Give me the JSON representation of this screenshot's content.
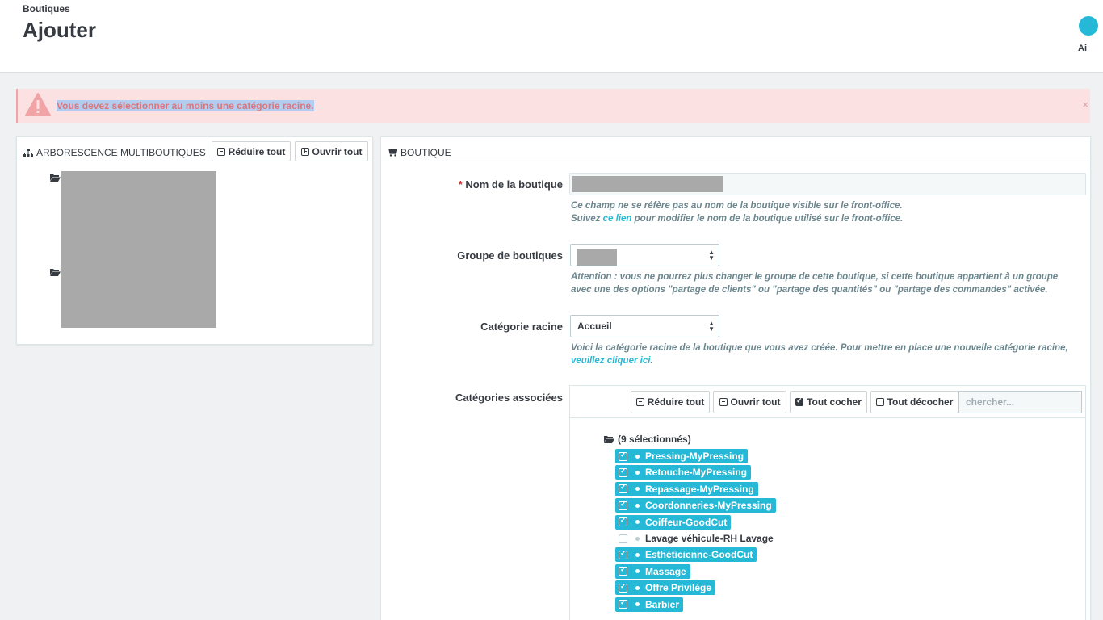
{
  "header": {
    "breadcrumb": "Boutiques",
    "title": "Ajouter",
    "help_label": "Ai"
  },
  "alert": {
    "message": "Vous devez sélectionner au moins une catégorie racine.",
    "close": "×"
  },
  "left_panel": {
    "title": "ARBORESCENCE MULTIBOUTIQUES",
    "collapse_label": "Réduire tout",
    "expand_label": "Ouvrir tout"
  },
  "right_panel": {
    "title": "BOUTIQUE",
    "shop_name": {
      "label": "Nom de la boutique",
      "required_mark": "*",
      "help_line1": "Ce champ ne se réfère pas au nom de la boutique visible sur le front-office.",
      "help_line2_prefix": "Suivez ",
      "help_link": "ce lien",
      "help_line2_suffix": " pour modifier le nom de la boutique utilisé sur le front-office."
    },
    "shop_group": {
      "label": "Groupe de boutiques",
      "help_line1": "Attention : vous ne pourrez plus changer le groupe de cette boutique, si cette boutique appartient à un groupe",
      "help_line2": "avec une des options \"partage de clients\" ou \"partage des quantités\" ou \"partage des commandes\" activée."
    },
    "root_category": {
      "label": "Catégorie racine",
      "value": "Accueil",
      "help_line1": "Voici la catégorie racine de la boutique que vous avez créée. Pour mettre en place une nouvelle catégorie racine,",
      "help_link": "veuillez cliquer ici",
      "help_suffix": "."
    },
    "associated_categories": {
      "label": "Catégories associées",
      "collapse_label": "Réduire tout",
      "expand_label": "Ouvrir tout",
      "check_all_label": "Tout cocher",
      "uncheck_all_label": "Tout décocher",
      "search_placeholder": "chercher...",
      "root_label": "(9 sélectionnés)",
      "items": [
        {
          "label": "Pressing-MyPressing",
          "selected": true
        },
        {
          "label": "Retouche-MyPressing",
          "selected": true
        },
        {
          "label": "Repassage-MyPressing",
          "selected": true
        },
        {
          "label": "Coordonneries-MyPressing",
          "selected": true
        },
        {
          "label": "Coiffeur-GoodCut",
          "selected": true
        },
        {
          "label": "Lavage véhicule-RH Lavage",
          "selected": false
        },
        {
          "label": "Esthéticienne-GoodCut",
          "selected": true
        },
        {
          "label": "Massage",
          "selected": true
        },
        {
          "label": "Offre Privilège",
          "selected": true
        },
        {
          "label": "Barbier",
          "selected": true
        }
      ]
    }
  },
  "colors": {
    "accent": "#25b9d7",
    "alert_bg": "#fbe1e2",
    "alert_text": "#d9777d",
    "text": "#363a41"
  },
  "icons": {
    "alert": "warning-triangle-icon",
    "tree": "sitemap-icon",
    "shop": "shopping-cart-icon",
    "folder": "folder-open-icon"
  }
}
